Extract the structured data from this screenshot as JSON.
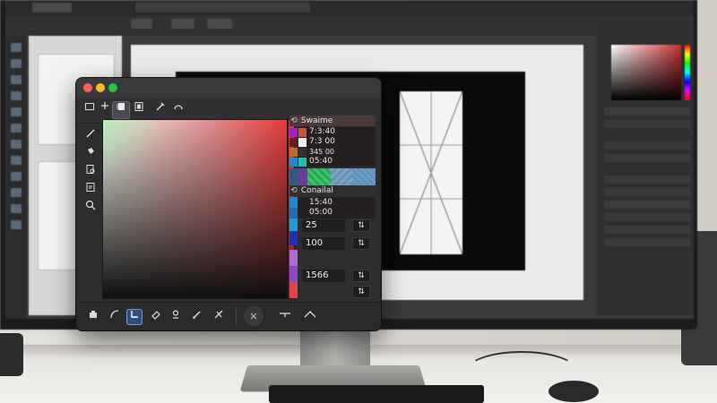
{
  "picker": {
    "swatches": {
      "title": "Swaime",
      "rows": [
        {
          "value": "7:3:40",
          "color": "#a21fcc"
        },
        {
          "value": "7:3 00",
          "color": "#6a1c20"
        },
        {
          "value": "345 00",
          "color": "#c26b31"
        },
        {
          "value": "05:40",
          "color": "#1a8ad2"
        }
      ]
    },
    "conditional": {
      "title": "Conailal",
      "line1": "15:40",
      "line2": "05:00",
      "value_a": "25",
      "value_b": "100",
      "value_c": "1566",
      "btn_symbol": "⇅"
    }
  },
  "colors": {
    "accent_blue": "#2f4f78",
    "window_bg": "#2d2d2f",
    "field_red": "#e53b3b"
  },
  "icons": {
    "mode_tools": [
      "square-icon",
      "plus-icon",
      "fill-icon",
      "box-icon",
      "eyedropper-icon",
      "loop-icon"
    ],
    "side_tools": [
      "brush-icon",
      "bucket-icon",
      "zoom-doc-icon",
      "text-doc-icon",
      "magnify-icon"
    ],
    "bottom_tools": [
      "tray-icon",
      "pen-curve-icon",
      "corner-icon",
      "eraser-icon",
      "pin-icon",
      "brush-icon",
      "cross-icon",
      "x-icon",
      "line-tool-icon",
      "chevron-up-icon"
    ]
  }
}
